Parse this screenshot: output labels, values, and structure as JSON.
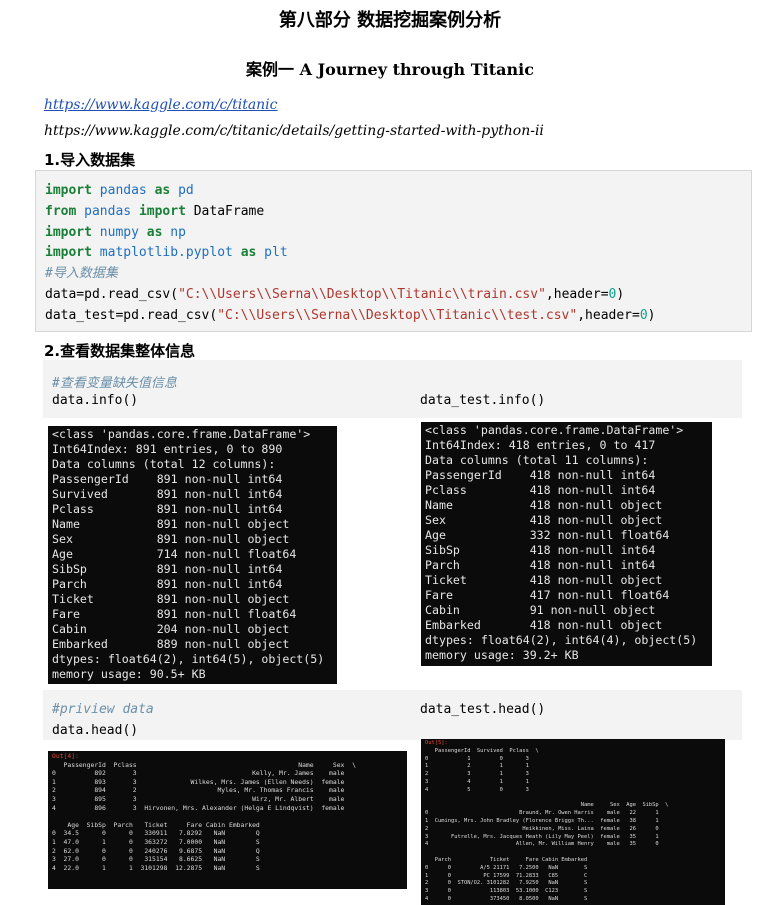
{
  "doc": {
    "part_title": "第八部分  数据挖掘案例分析",
    "case_title": "案例一    A Journey through Titanic",
    "link1": "https://www.kaggle.com/c/titanic",
    "link2": "https://www.kaggle.com/c/titanic/details/getting-started-with-python-ii",
    "section1": "1.导入数据集",
    "section2": "2.查看数据集整体信息"
  },
  "code1": {
    "l1": [
      "import",
      " pandas ",
      "as",
      " pd"
    ],
    "l2": [
      "from",
      " pandas ",
      "import",
      " DataFrame"
    ],
    "l3": [
      "import",
      " numpy ",
      "as",
      " np"
    ],
    "l4": [
      "import",
      " matplotlib.pyplot ",
      "as",
      " plt"
    ],
    "l5": "#导入数据集",
    "l6": [
      "data=pd.read_csv(",
      "\"C:\\\\Users\\\\Serna\\\\Desktop\\\\Titanic\\\\train.csv\"",
      ",header=",
      "0",
      ")"
    ],
    "l7": [
      "data_test=pd.read_csv(",
      "\"C:\\\\Users\\\\Serna\\\\Desktop\\\\Titanic\\\\test.csv\"",
      ",header=",
      "0",
      ")"
    ]
  },
  "code2": {
    "comment": "#查看变量缺失值信息",
    "left": "data.info()",
    "right": "data_test.info()"
  },
  "code3": {
    "comment": "#priview data",
    "left": "data.head()",
    "right": "data_test.head()"
  },
  "train_info": [
    "<class 'pandas.core.frame.DataFrame'>",
    "Int64Index: 891 entries, 0 to 890",
    "Data columns (total 12 columns):",
    "PassengerId    891 non-null int64",
    "Survived       891 non-null int64",
    "Pclass         891 non-null int64",
    "Name           891 non-null object",
    "Sex            891 non-null object",
    "Age            714 non-null float64",
    "SibSp          891 non-null int64",
    "Parch          891 non-null int64",
    "Ticket         891 non-null object",
    "Fare           891 non-null float64",
    "Cabin          204 non-null object",
    "Embarked       889 non-null object",
    "dtypes: float64(2), int64(5), object(5)",
    "memory usage: 90.5+ KB"
  ],
  "test_info": [
    "<class 'pandas.core.frame.DataFrame'>",
    "Int64Index: 418 entries, 0 to 417",
    "Data columns (total 11 columns):",
    "PassengerId    418 non-null int64",
    "Pclass         418 non-null int64",
    "Name           418 non-null object",
    "Sex            418 non-null object",
    "Age            332 non-null float64",
    "SibSp          418 non-null int64",
    "Parch          418 non-null int64",
    "Ticket         418 non-null object",
    "Fare           417 non-null float64",
    "Cabin          91 non-null object",
    "Embarked       418 non-null object",
    "dtypes: float64(2), int64(4), object(5)",
    "memory usage: 39.2+ KB"
  ],
  "test_head_out": "Out[4]:",
  "test_head": [
    "   PassengerId  Pclass                                          Name     Sex  \\",
    "0          892       3                              Kelly, Mr. James    male",
    "1          893       3              Wilkes, Mrs. James (Ellen Needs)  female",
    "2          894       2                     Myles, Mr. Thomas Francis    male",
    "3          895       3                              Wirz, Mr. Albert    male",
    "4          896       3  Hirvonen, Mrs. Alexander (Helga E Lindqvist)  female",
    "",
    "    Age  SibSp  Parch   Ticket     Fare Cabin Embarked",
    "0  34.5      0      0   330911   7.8292   NaN        Q",
    "1  47.0      1      0   363272   7.0000   NaN        S",
    "2  62.0      0      0   240276   9.6875   NaN        Q",
    "3  27.0      0      0   315154   8.6625   NaN        S",
    "4  22.0      1      1  3101298  12.2875   NaN        S"
  ],
  "train_head_out": "Out[5]:",
  "train_head": [
    "   PassengerId  Survived  Pclass  \\",
    "0            1         0       3",
    "1            2         1       1",
    "2            3         1       3",
    "3            4         1       1",
    "4            5         0       3",
    "",
    "                                                Name     Sex  Age  SibSp  \\",
    "0                            Braund, Mr. Owen Harris    male   22      1",
    "1  Cumings, Mrs. John Bradley (Florence Briggs Th...  female   38      1",
    "2                             Heikkinen, Miss. Laina  female   26      0",
    "3       Futrelle, Mrs. Jacques Heath (Lily May Peel)  female   35      1",
    "4                           Allen, Mr. William Henry    male   35      0",
    "",
    "   Parch            Ticket     Fare Cabin Embarked",
    "0      0         A/5 21171   7.2500   NaN        S",
    "1      0          PC 17599  71.2833   C85        C",
    "2      0  STON/O2. 3101282   7.9250   NaN        S",
    "3      0            113803  53.1000  C123        S",
    "4      0            373450   8.0500   NaN        S"
  ]
}
